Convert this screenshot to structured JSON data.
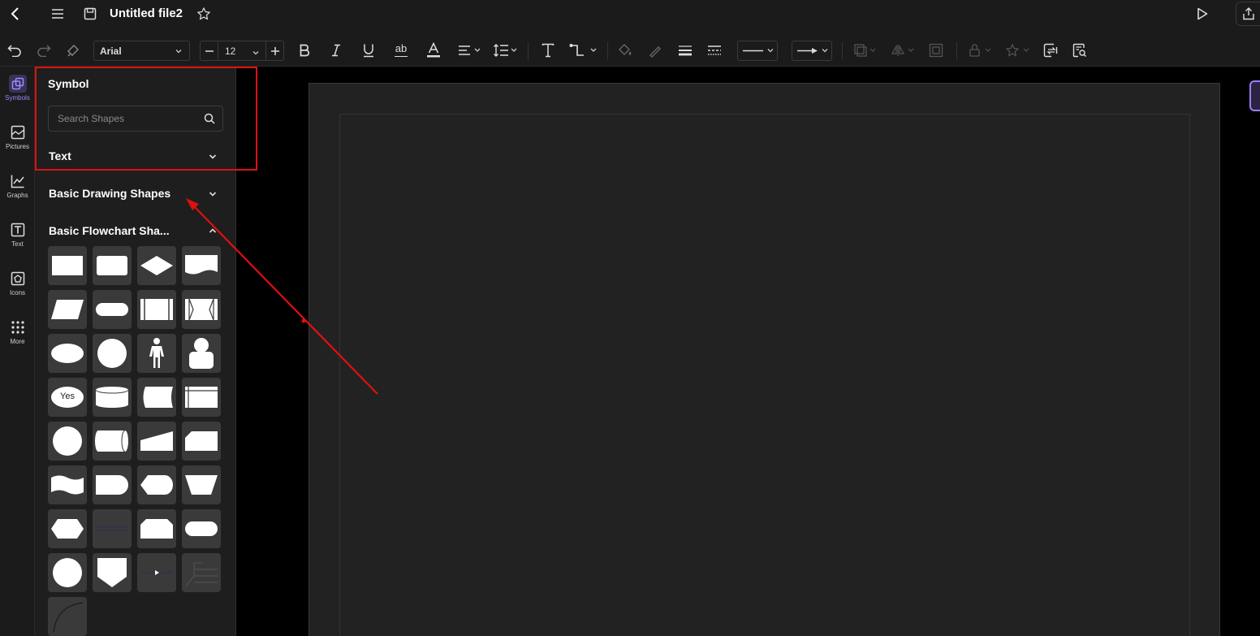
{
  "title_bar": {
    "file_name": "Untitled file2"
  },
  "toolbar": {
    "font_family": "Arial",
    "font_size": "12",
    "underline_strike_label": "ab",
    "text_tool_label": "T"
  },
  "rail": {
    "items": [
      {
        "label": "Symbols",
        "icon": "symbols-icon",
        "active": true
      },
      {
        "label": "Pictures",
        "icon": "pictures-icon",
        "active": false
      },
      {
        "label": "Graphs",
        "icon": "graphs-icon",
        "active": false
      },
      {
        "label": "Text",
        "icon": "text-icon",
        "active": false
      },
      {
        "label": "Icons",
        "icon": "icons-icon",
        "active": false
      },
      {
        "label": "More",
        "icon": "more-icon",
        "active": false
      }
    ]
  },
  "panel": {
    "title": "Symbol",
    "search_placeholder": "Search Shapes",
    "sections": [
      {
        "label": "Text",
        "state": "collapsed"
      },
      {
        "label": "Basic Drawing Shapes",
        "state": "collapsed"
      },
      {
        "label": "Basic Flowchart Sha...",
        "state": "expanded"
      }
    ],
    "flowchart_shape_labels": {
      "decision_yes": "Yes"
    }
  },
  "colors": {
    "accent": "#9b8cff",
    "annotation_red": "#e01010",
    "canvas_bg": "#222222",
    "panel_bg": "#1e1e1e"
  }
}
